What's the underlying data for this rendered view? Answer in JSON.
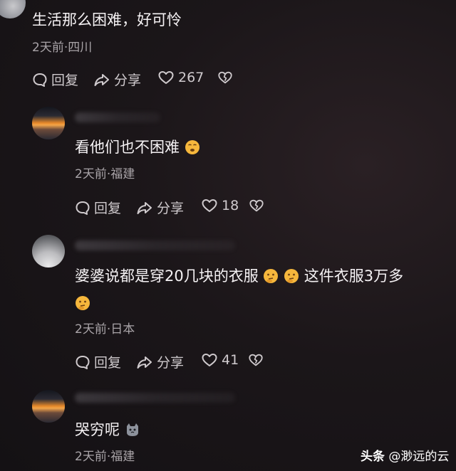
{
  "comments": [
    {
      "text": "生活那么困难，好可怜",
      "time": "2天前",
      "location": "四川",
      "reply_label": "回复",
      "share_label": "分享",
      "likes": "267",
      "avatar": "gray-orb"
    },
    {
      "text": "看他们也不困难",
      "emoji": "smirk-emoji",
      "time": "2天前",
      "location": "福建",
      "reply_label": "回复",
      "share_label": "分享",
      "likes": "18",
      "avatar": "sunset"
    },
    {
      "text_line1": "婆婆说都是穿20几块的衣服",
      "text_line1b": "这件衣服3万多",
      "emoji": "thinking-emoji",
      "time": "2天前",
      "location": "日本",
      "reply_label": "回复",
      "share_label": "分享",
      "likes": "41",
      "avatar": "person-photo"
    },
    {
      "text": "哭穷呢",
      "emoji": "cat-emoji",
      "time": "2天前",
      "location": "福建",
      "avatar": "sunset"
    }
  ],
  "separator": "·",
  "watermark": {
    "brand": "头条",
    "handle": "@渺远的云"
  },
  "colors": {
    "background": "#181418",
    "text": "#f5f2f4",
    "meta": "#a9a4a8"
  }
}
